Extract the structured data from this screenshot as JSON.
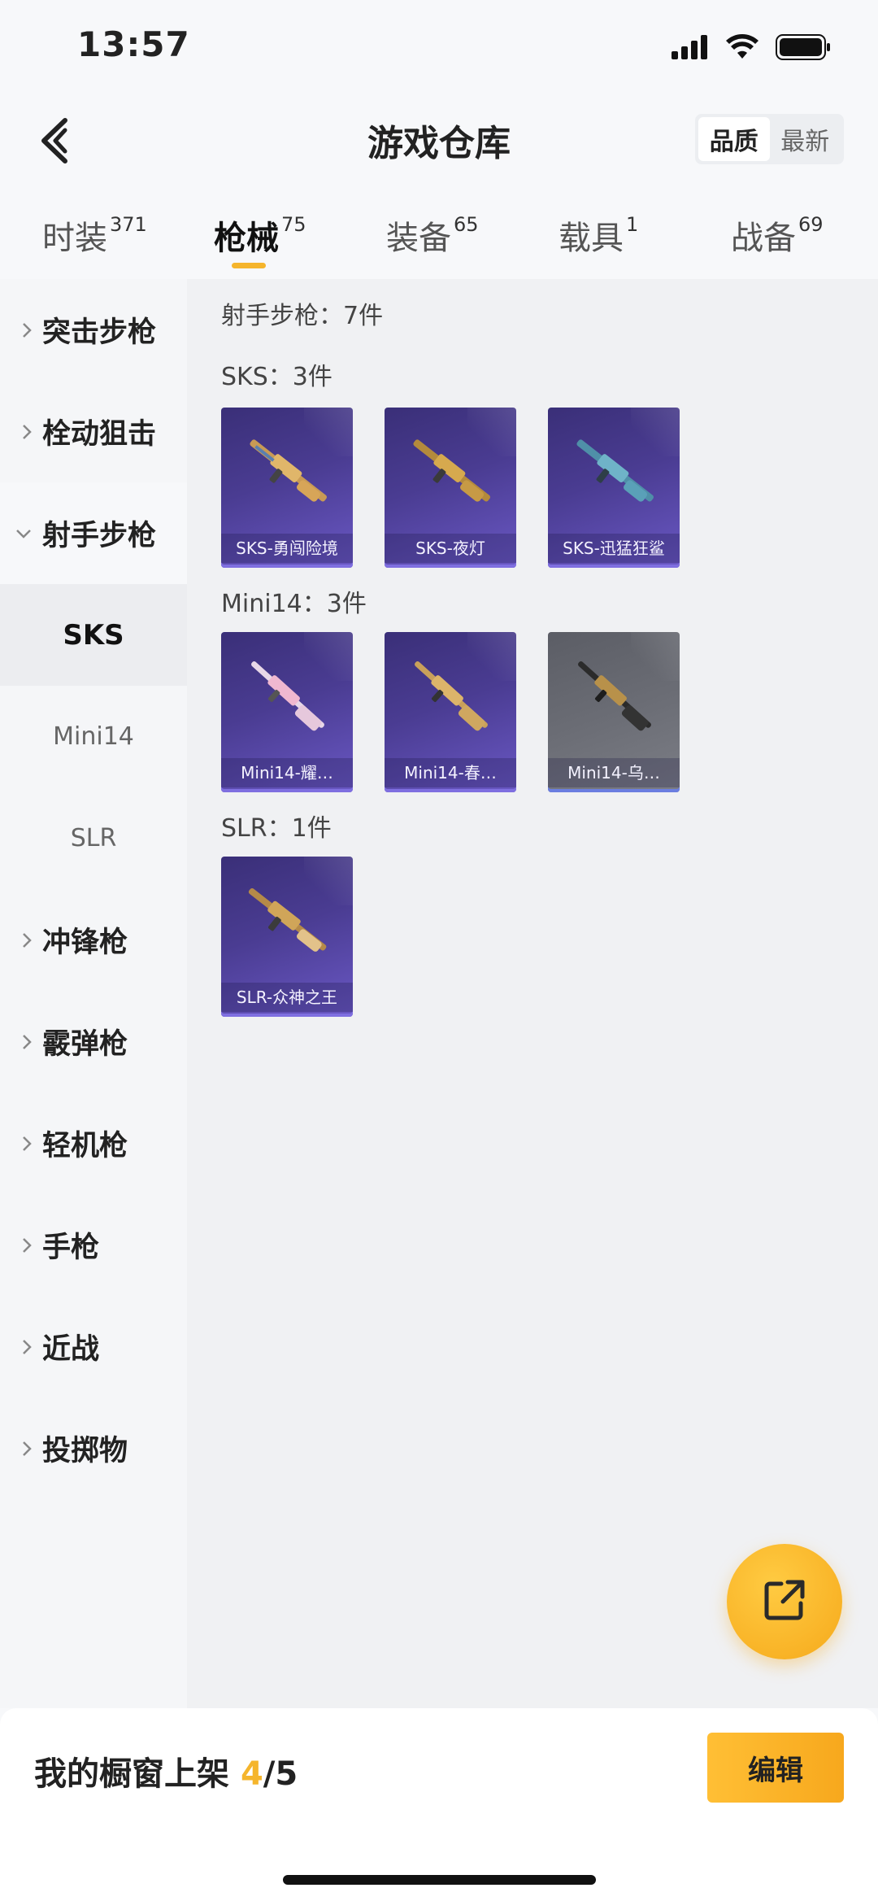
{
  "status": {
    "time": "13:57"
  },
  "header": {
    "title": "游戏仓库",
    "sort_quality": "品质",
    "sort_newest": "最新"
  },
  "tabs": [
    {
      "label": "时装",
      "count": "371"
    },
    {
      "label": "枪械",
      "count": "75"
    },
    {
      "label": "装备",
      "count": "65"
    },
    {
      "label": "载具",
      "count": "1"
    },
    {
      "label": "战备",
      "count": "69"
    }
  ],
  "sidebar": {
    "categories": [
      {
        "label": "突击步枪"
      },
      {
        "label": "栓动狙击"
      },
      {
        "label": "射手步枪"
      },
      {
        "label": "冲锋枪"
      },
      {
        "label": "霰弹枪"
      },
      {
        "label": "轻机枪"
      },
      {
        "label": "手枪"
      },
      {
        "label": "近战"
      },
      {
        "label": "投掷物"
      }
    ],
    "subitems": [
      {
        "label": "SKS"
      },
      {
        "label": "Mini14"
      },
      {
        "label": "SLR"
      }
    ]
  },
  "content": {
    "category_title": "射手步枪：7件",
    "groups": [
      {
        "title": "SKS：3件",
        "items": [
          "SKS-勇闯险境",
          "SKS-夜灯",
          "SKS-迅猛狂鲨"
        ]
      },
      {
        "title": "Mini14：3件",
        "items": [
          "Mini14-耀…",
          "Mini14-春…",
          "Mini14-乌…"
        ]
      },
      {
        "title": "SLR：1件",
        "items": [
          "SLR-众神之王"
        ]
      }
    ]
  },
  "bottom": {
    "shelf_label": "我的橱窗上架",
    "shelf_current": "4",
    "shelf_total": "/5",
    "edit_label": "编辑"
  },
  "colors": {
    "accent": "#f5b52c",
    "card_purple": "#4a3c92",
    "card_grey": "#6c6e76"
  },
  "icons": {
    "back": "chevron-left-icon",
    "share": "external-link-icon",
    "signal": "signal-icon",
    "wifi": "wifi-icon",
    "battery": "battery-icon"
  }
}
